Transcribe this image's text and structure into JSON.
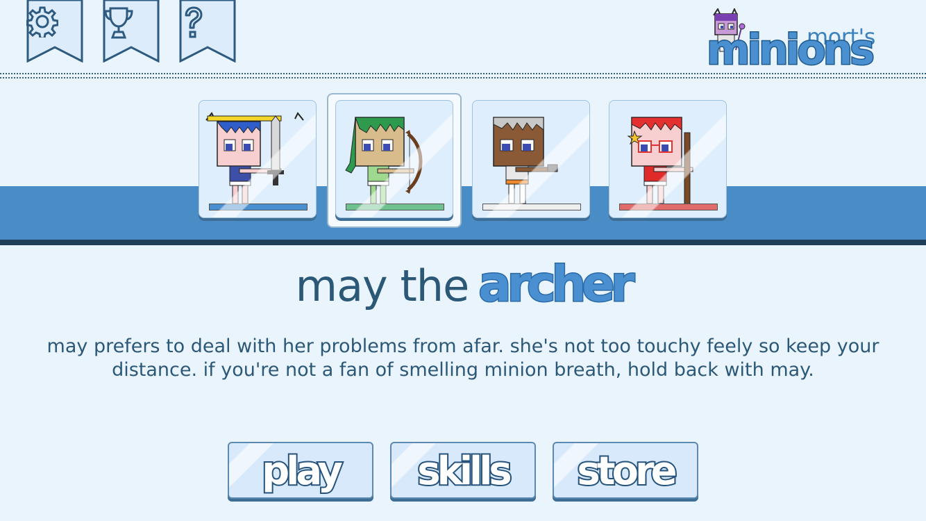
{
  "top_buttons": [
    {
      "icon": "gear-icon"
    },
    {
      "icon": "trophy-icon"
    },
    {
      "icon": "question-icon"
    }
  ],
  "logo": {
    "line1": "mort's",
    "line2": "minions"
  },
  "characters": [
    {
      "name": "sword-minion",
      "hair": "#2f5ecb",
      "shirt": "#3e4fa8",
      "bar": "#4a8fd0"
    },
    {
      "name": "archer-minion",
      "hair": "#2e9a4e",
      "shirt": "#9ed98f",
      "bar": "#6fc190"
    },
    {
      "name": "gunner-minion",
      "hair": "#9a9a9a",
      "shirt": "#8a5a36",
      "bar": "#eeeeee"
    },
    {
      "name": "staff-minion",
      "hair": "#e53030",
      "shirt": "#e02a2a",
      "bar": "#e06b6b"
    }
  ],
  "selected_index": 1,
  "title": {
    "name": "may the",
    "class": "archer"
  },
  "description": "may prefers to deal with her problems from afar. she's not too touchy feely so keep your distance. if you're not a fan of smelling minion breath, hold back with may.",
  "buttons": {
    "play": "play",
    "skills": "skills",
    "store": "store"
  },
  "colors": {
    "background": "#eaf4fd",
    "band": "#4a8dc6",
    "accent": "#4a8fd0",
    "text": "#2c5877"
  }
}
